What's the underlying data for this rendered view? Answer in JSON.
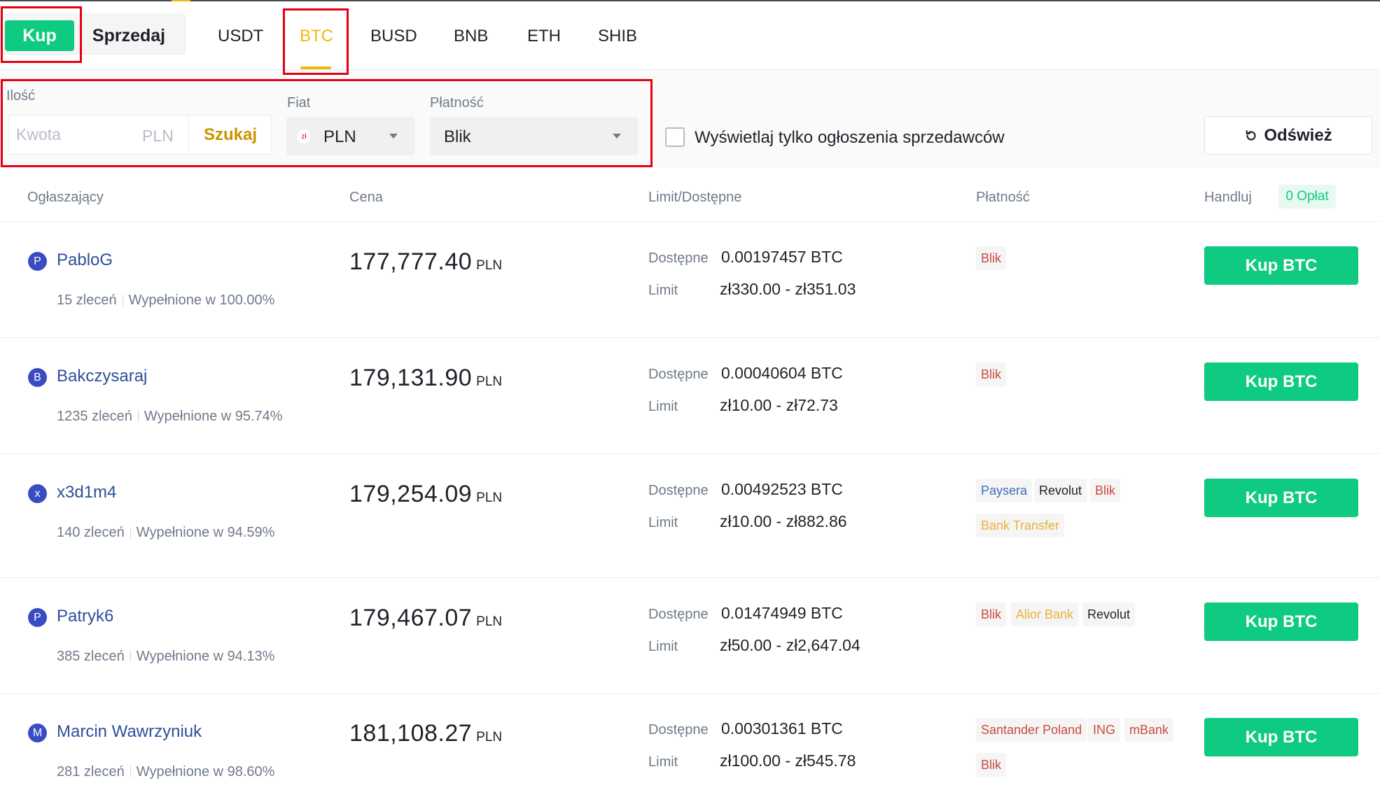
{
  "side": {
    "buy_label": "Kup",
    "sell_label": "Sprzedaj"
  },
  "assets": [
    "USDT",
    "BTC",
    "BUSD",
    "BNB",
    "ETH",
    "SHIB"
  ],
  "filters": {
    "amount_label": "Ilość",
    "amount_placeholder": "Kwota",
    "amount_unit": "PLN",
    "search_label": "Szukaj",
    "fiat_label": "Fiat",
    "fiat_icon": "zł",
    "fiat_value": "PLN",
    "payment_label": "Płatność",
    "payment_value": "Blik",
    "merchant_only_label": "Wyświetlaj tylko ogłoszenia sprzedawców",
    "refresh_label": "Odśwież"
  },
  "table_headers": {
    "advertiser": "Ogłaszający",
    "price": "Cena",
    "limit": "Limit/Dostępne",
    "payment": "Płatność",
    "trade": "Handluj",
    "zero_fee": "0 Opłat"
  },
  "colors": {
    "green": "#0ecb81",
    "gold": "#f0b90b",
    "red_outline": "#e60012",
    "payment_red": "#c94b40",
    "payment_yellow": "#e8b339",
    "payment_blue": "#3f6db5",
    "payment_dark": "#1e2329"
  },
  "offers": [
    {
      "avatar": "P",
      "name": "PabloG",
      "orders": "15 zleceń",
      "completion": "Wypełnione w 100.00%",
      "price": "177,777.40",
      "currency": "PLN",
      "available_label": "Dostępne",
      "available": "0.00197457 BTC",
      "limit_label": "Limit",
      "limit": "zł330.00 - zł351.03",
      "payments": [
        {
          "name": "Blik",
          "color": "#c94b40"
        }
      ],
      "button": "Kup BTC"
    },
    {
      "avatar": "B",
      "name": "Bakczysaraj",
      "orders": "1235 zleceń",
      "completion": "Wypełnione w 95.74%",
      "price": "179,131.90",
      "currency": "PLN",
      "available_label": "Dostępne",
      "available": "0.00040604 BTC",
      "limit_label": "Limit",
      "limit": "zł10.00 - zł72.73",
      "payments": [
        {
          "name": "Blik",
          "color": "#c94b40"
        }
      ],
      "button": "Kup BTC"
    },
    {
      "avatar": "x",
      "name": "x3d1m4",
      "orders": "140 zleceń",
      "completion": "Wypełnione w 94.59%",
      "price": "179,254.09",
      "currency": "PLN",
      "available_label": "Dostępne",
      "available": "0.00492523 BTC",
      "limit_label": "Limit",
      "limit": "zł10.00 - zł882.86",
      "payments": [
        {
          "name": "Paysera",
          "color": "#3f6db5"
        },
        {
          "name": "Revolut",
          "color": "#1e2329"
        },
        {
          "name": "Blik",
          "color": "#c94b40"
        },
        {
          "name": "Bank Transfer",
          "color": "#e8b339"
        }
      ],
      "button": "Kup BTC"
    },
    {
      "avatar": "P",
      "name": "Patryk6",
      "orders": "385 zleceń",
      "completion": "Wypełnione w 94.13%",
      "price": "179,467.07",
      "currency": "PLN",
      "available_label": "Dostępne",
      "available": "0.01474949 BTC",
      "limit_label": "Limit",
      "limit": "zł50.00 - zł2,647.04",
      "payments": [
        {
          "name": "Blik",
          "color": "#c94b40"
        },
        {
          "name": "Alior Bank",
          "color": "#e8b339"
        },
        {
          "name": "Revolut",
          "color": "#1e2329"
        }
      ],
      "button": "Kup BTC"
    },
    {
      "avatar": "M",
      "name": "Marcin Wawrzyniuk",
      "orders": "281 zleceń",
      "completion": "Wypełnione w 98.60%",
      "price": "181,108.27",
      "currency": "PLN",
      "available_label": "Dostępne",
      "available": "0.00301361 BTC",
      "limit_label": "Limit",
      "limit": "zł100.00 - zł545.78",
      "payments": [
        {
          "name": "Santander Poland",
          "color": "#c94b40"
        },
        {
          "name": "ING",
          "color": "#c94b40"
        },
        {
          "name": "mBank",
          "color": "#c94b40"
        },
        {
          "name": "Blik",
          "color": "#c94b40"
        }
      ],
      "button": "Kup BTC"
    }
  ]
}
